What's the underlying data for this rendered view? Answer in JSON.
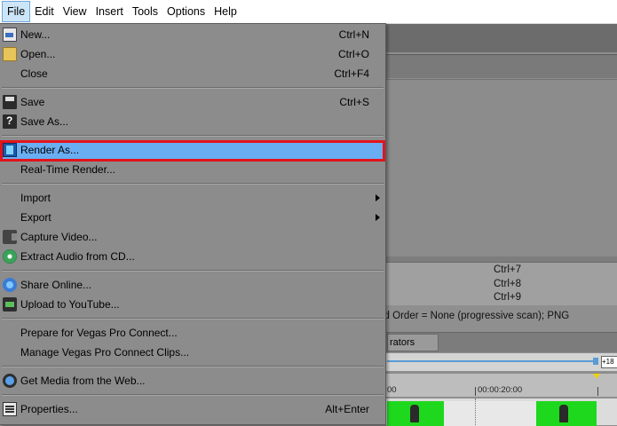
{
  "menubar": {
    "items": [
      "File",
      "Edit",
      "View",
      "Insert",
      "Tools",
      "Options",
      "Help"
    ]
  },
  "background": {
    "shortcuts": [
      "Ctrl+7",
      "Ctrl+8",
      "Ctrl+9"
    ],
    "field_order_text": "ld Order = None (progressive scan); PNG",
    "tab_label": "rators",
    "scrub_value": "+18",
    "ruler_marks": [
      "00",
      "00:00:20:00"
    ]
  },
  "file_menu": {
    "new": {
      "label": "New...",
      "shortcut": "Ctrl+N"
    },
    "open": {
      "label": "Open...",
      "shortcut": "Ctrl+O"
    },
    "close": {
      "label": "Close",
      "shortcut": "Ctrl+F4"
    },
    "save": {
      "label": "Save",
      "shortcut": "Ctrl+S"
    },
    "save_as": {
      "label": "Save As..."
    },
    "render_as": {
      "label": "Render As..."
    },
    "real_time_render": {
      "label": "Real-Time Render..."
    },
    "import": {
      "label": "Import"
    },
    "export": {
      "label": "Export"
    },
    "capture_video": {
      "label": "Capture Video..."
    },
    "extract_audio": {
      "label": "Extract Audio from CD..."
    },
    "share_online": {
      "label": "Share Online..."
    },
    "upload_youtube": {
      "label": "Upload to YouTube..."
    },
    "prepare_connect": {
      "label": "Prepare for Vegas Pro Connect..."
    },
    "manage_connect": {
      "label": "Manage Vegas Pro Connect Clips..."
    },
    "get_media": {
      "label": "Get Media from the Web..."
    },
    "properties": {
      "label": "Properties...",
      "shortcut": "Alt+Enter"
    }
  },
  "colors": {
    "highlight": "#6aaef2",
    "annotation_box": "#e3141c"
  }
}
